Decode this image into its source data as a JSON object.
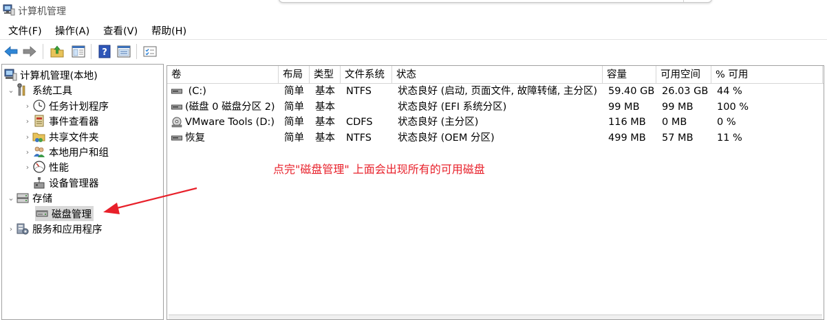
{
  "window": {
    "title": "计算机管理",
    "icon": "computer-management-icon"
  },
  "menu": [
    "文件(F)",
    "操作(A)",
    "查看(V)",
    "帮助(H)"
  ],
  "toolbar": [
    "back-arrow-icon",
    "forward-arrow-icon",
    "up-folder-icon",
    "show-hide-tree-icon",
    "help-icon",
    "properties-icon",
    "checklist-icon"
  ],
  "tree": {
    "root": "计算机管理(本地)",
    "system_tools": "系统工具",
    "task_scheduler": "任务计划程序",
    "event_viewer": "事件查看器",
    "shared_folders": "共享文件夹",
    "local_users": "本地用户和组",
    "performance": "性能",
    "device_manager": "设备管理器",
    "storage": "存储",
    "disk_management": "磁盘管理",
    "services": "服务和应用程序"
  },
  "table": {
    "headers": [
      "卷",
      "布局",
      "类型",
      "文件系统",
      "状态",
      "容量",
      "可用空间",
      "% 可用"
    ],
    "rows": [
      {
        "volume": " (C:)",
        "layout": "简单",
        "type": "基本",
        "fs": "NTFS",
        "status": "状态良好 (启动, 页面文件, 故障转储, 主分区)",
        "capacity": "59.40 GB",
        "free": "26.03 GB",
        "pct": "44 %"
      },
      {
        "volume": "(磁盘 0 磁盘分区 2)",
        "layout": "简单",
        "type": "基本",
        "fs": "",
        "status": "状态良好 (EFI 系统分区)",
        "capacity": "99 MB",
        "free": "99 MB",
        "pct": "100 %"
      },
      {
        "volume": "VMware Tools (D:)",
        "layout": "简单",
        "type": "基本",
        "fs": "CDFS",
        "status": "状态良好 (主分区)",
        "capacity": "116 MB",
        "free": "0 MB",
        "pct": "0 %"
      },
      {
        "volume": "恢复",
        "layout": "简单",
        "type": "基本",
        "fs": "NTFS",
        "status": "状态良好 (OEM 分区)",
        "capacity": "499 MB",
        "free": "57 MB",
        "pct": "11 %"
      }
    ]
  },
  "annotation": "点完\"磁盘管理\" 上面会出现所有的可用磁盘",
  "colors": {
    "annotation": "#e8202a",
    "selection": "#d9d9d9",
    "border": "#a0a0a0"
  }
}
